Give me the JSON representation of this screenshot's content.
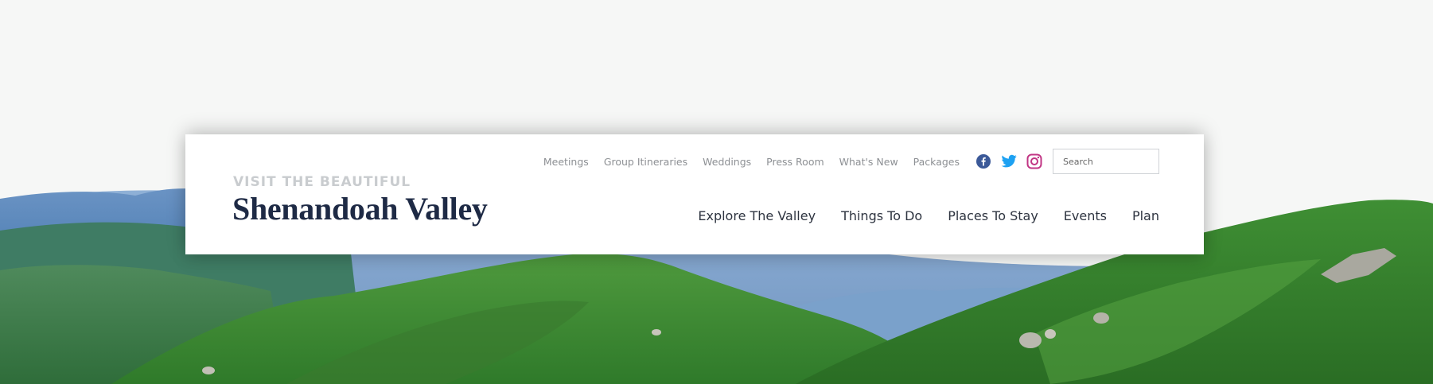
{
  "brand": {
    "tagline": "VISIT THE BEAUTIFUL",
    "name": "Shenandoah Valley",
    "name_color": "#1e2a45",
    "tagline_color": "#c9cccf"
  },
  "utility_nav": {
    "items": [
      {
        "label": "Meetings"
      },
      {
        "label": "Group Itineraries"
      },
      {
        "label": "Weddings"
      },
      {
        "label": "Press Room"
      },
      {
        "label": "What's New"
      },
      {
        "label": "Packages"
      }
    ]
  },
  "social": [
    {
      "icon": "facebook-icon",
      "color": "#3b5998"
    },
    {
      "icon": "twitter-icon",
      "color": "#1da1f2"
    },
    {
      "icon": "instagram-icon",
      "color": "#c13584"
    }
  ],
  "search": {
    "placeholder": "Search",
    "value": ""
  },
  "main_nav": {
    "items": [
      {
        "label": "Explore The Valley"
      },
      {
        "label": "Things To Do"
      },
      {
        "label": "Places To Stay"
      },
      {
        "label": "Events"
      },
      {
        "label": "Plan"
      }
    ]
  },
  "hero": {
    "image": "mountain-landscape",
    "sky_color": "#f6f7f6"
  }
}
